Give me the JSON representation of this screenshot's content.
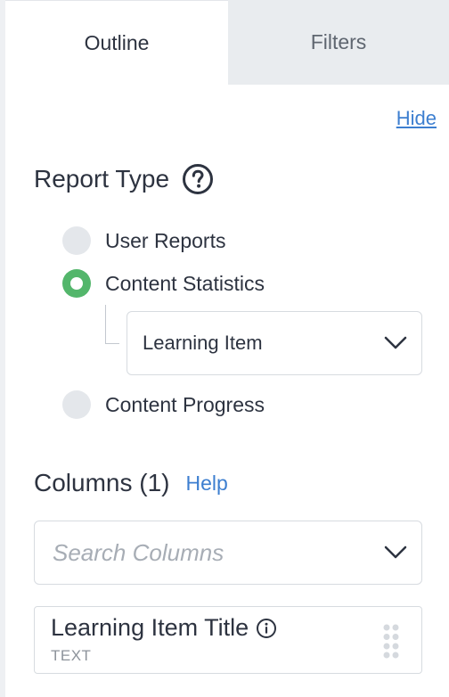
{
  "tabs": [
    {
      "label": "Outline",
      "active": true
    },
    {
      "label": "Filters",
      "active": false
    }
  ],
  "hide_label": "Hide",
  "report_type": {
    "title": "Report Type",
    "options": [
      {
        "label": "User Reports",
        "selected": false
      },
      {
        "label": "Content Statistics",
        "selected": true
      },
      {
        "label": "Content Progress",
        "selected": false
      }
    ],
    "content_select_value": "Learning Item"
  },
  "columns": {
    "title": "Columns (1)",
    "help_label": "Help",
    "search_placeholder": "Search Columns",
    "items": [
      {
        "title": "Learning Item Title",
        "type": "TEXT"
      }
    ]
  },
  "colors": {
    "accent": "#3d7fd0",
    "radio_selected": "#53b66b",
    "radio_unselected": "#e4e7eb"
  }
}
